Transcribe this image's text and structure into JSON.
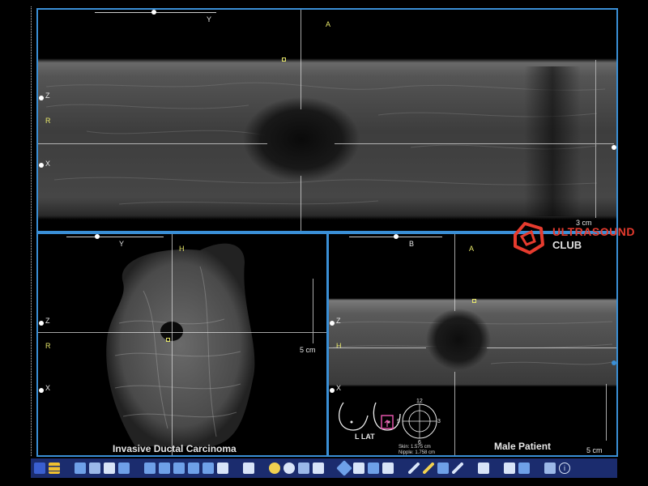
{
  "top_panel": {
    "labels": {
      "y": "Y",
      "a": "A",
      "z": "Z",
      "r": "R",
      "x": "X"
    },
    "scale": "3 cm"
  },
  "bottom_left_panel": {
    "labels": {
      "y": "Y",
      "h": "H",
      "z": "Z",
      "r": "R",
      "x": "X"
    },
    "scale": "5 cm",
    "caption": "Invasive Ductal Carcinoma"
  },
  "bottom_right_panel": {
    "labels": {
      "b": "B",
      "a": "A",
      "z": "Z",
      "h": "H",
      "x": "X"
    },
    "scale": "5 cm",
    "caption": "Male Patient",
    "bodymark": {
      "side_label": "L LAT",
      "clock": {
        "n12": "12",
        "n3": "3",
        "n6": "6",
        "n9": "9"
      },
      "skin_label": "Skin:",
      "skin_value": "1.575 cm",
      "nipple_label": "Nipple:",
      "nipple_value": "1.758 cm"
    }
  },
  "logo": {
    "line1": "ULTRASOUND",
    "line2": "CLUB"
  },
  "colors": {
    "panel_border": "#3a8fd6",
    "toolbar_bg": "#1b2c6e",
    "logo_red": "#e63b2e",
    "annotation_yellow": "#e8e86a"
  },
  "toolbar": {
    "icons": [
      "layout-icon",
      "list-icon",
      "volume-icon",
      "slice-icon",
      "plane-add-icon",
      "plane-remove-icon",
      "grid-1-icon",
      "grid-2-icon",
      "grid-3-icon",
      "grid-4-icon",
      "grid-5-icon",
      "grid-6-icon",
      "center-icon",
      "brightness-icon",
      "zoom-icon",
      "pan-icon",
      "measure-icon",
      "rotate-icon",
      "reset-icon",
      "render-icon",
      "cut-icon",
      "pen-icon",
      "line-icon",
      "caliper-icon",
      "annotate-icon",
      "save-icon",
      "print-icon",
      "export-icon",
      "info-icon"
    ]
  }
}
